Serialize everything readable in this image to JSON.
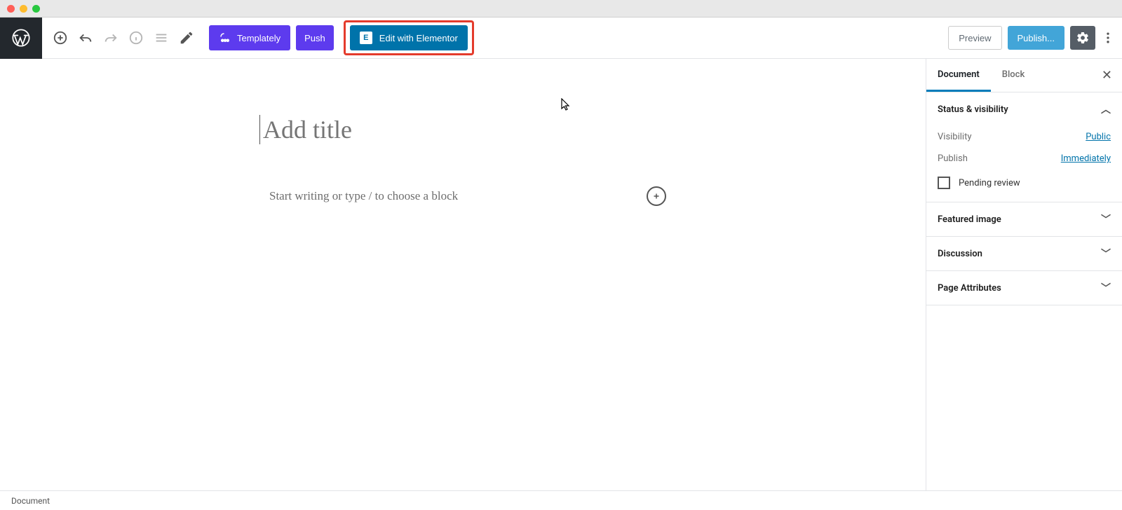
{
  "toolbar": {
    "templately_label": "Templately",
    "push_label": "Push",
    "elementor_label": "Edit with Elementor",
    "preview_label": "Preview",
    "publish_label": "Publish..."
  },
  "editor": {
    "title_placeholder": "Add title",
    "content_placeholder": "Start writing or type / to choose a block"
  },
  "sidebar": {
    "tabs": {
      "document": "Document",
      "block": "Block"
    },
    "panels": {
      "status": {
        "title": "Status & visibility",
        "visibility_label": "Visibility",
        "visibility_value": "Public",
        "publish_label": "Publish",
        "publish_value": "Immediately",
        "pending_label": "Pending review"
      },
      "featured_image": "Featured image",
      "discussion": "Discussion",
      "page_attributes": "Page Attributes"
    }
  },
  "footer": {
    "breadcrumb": "Document"
  }
}
